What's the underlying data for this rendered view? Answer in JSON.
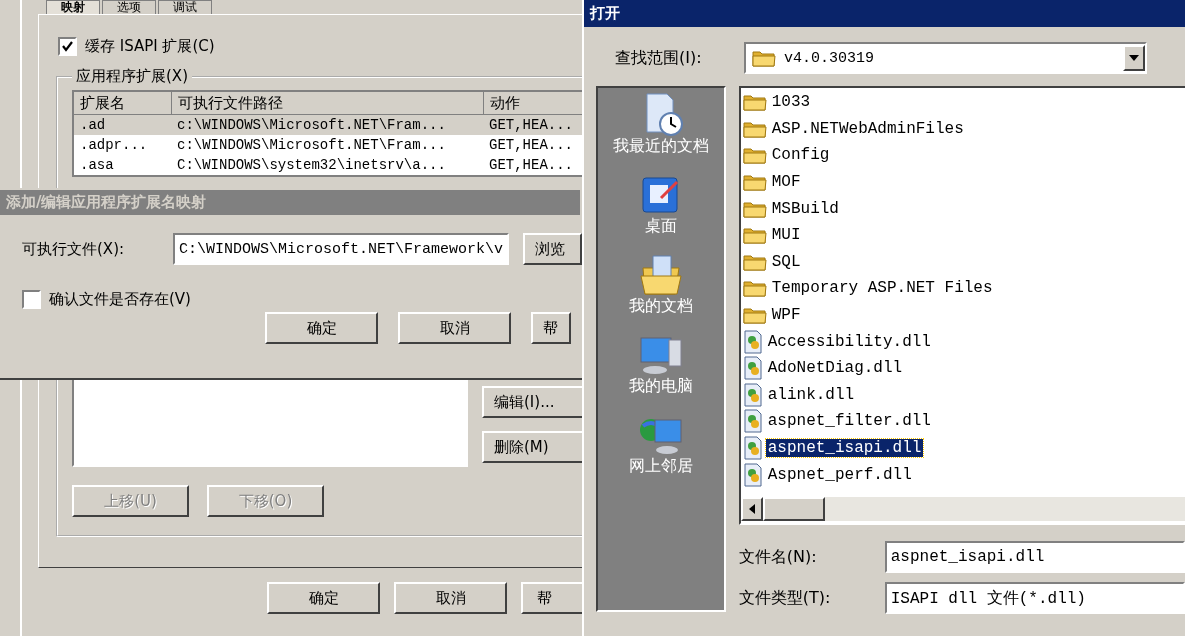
{
  "background_window": {
    "tabs": [
      {
        "label": "映射",
        "selected": true
      },
      {
        "label": "选项",
        "selected": false
      },
      {
        "label": "调试",
        "selected": false
      }
    ],
    "cache_checkbox": {
      "label": "缓存 ISAPI 扩展(C)",
      "checked": true
    },
    "group_label": "应用程序扩展(X)",
    "extensions_table": {
      "columns": [
        "扩展名",
        "可执行文件路径",
        "动作"
      ],
      "rows": [
        {
          "cells": [
            ".ad",
            "c:\\WINDOWS\\Microsoft.NET\\Fram...",
            "GET,HEA..."
          ],
          "selected": true
        },
        {
          "cells": [
            ".adpr...",
            "c:\\WINDOWS\\Microsoft.NET\\Fram...",
            "GET,HEA..."
          ],
          "selected": false
        },
        {
          "cells": [
            ".asa",
            "C:\\WINDOWS\\system32\\inetsrv\\a...",
            "GET,HEA..."
          ],
          "selected": false
        }
      ]
    },
    "wildcard_buttons": [
      {
        "label": "编辑(I)...",
        "disabled": false
      },
      {
        "label": "删除(M)",
        "disabled": false
      }
    ],
    "move_buttons": [
      {
        "label": "上移(U)",
        "disabled": true
      },
      {
        "label": "下移(O)",
        "disabled": true
      }
    ],
    "buttons": [
      "确定",
      "取消",
      "帮"
    ]
  },
  "edit_dialog": {
    "title": "添加/编辑应用程序扩展名映射",
    "active": false,
    "executable_label": "可执行文件(X):",
    "executable_value": "C:\\WINDOWS\\Microsoft.NET\\Framework\\v",
    "browse_button": "浏览",
    "verify_checkbox": {
      "label": "确认文件是否存在(V)",
      "checked": false
    },
    "buttons": [
      "确定",
      "取消",
      "帮"
    ]
  },
  "open_dialog": {
    "title": "打开",
    "active": true,
    "look_in_label": "查找范围(I):",
    "look_in_value": "v4.0.30319",
    "places": [
      {
        "label": "我最近的文档",
        "kind": "recent"
      },
      {
        "label": "桌面",
        "kind": "desktop"
      },
      {
        "label": "我的文档",
        "kind": "documents"
      },
      {
        "label": "我的电脑",
        "kind": "computer"
      },
      {
        "label": "网上邻居",
        "kind": "network"
      }
    ],
    "files": [
      {
        "name": "1033",
        "kind": "folder",
        "selected": false
      },
      {
        "name": "ASP.NETWebAdminFiles",
        "kind": "folder",
        "selected": false
      },
      {
        "name": "Config",
        "kind": "folder",
        "selected": false
      },
      {
        "name": "MOF",
        "kind": "folder",
        "selected": false
      },
      {
        "name": "MSBuild",
        "kind": "folder",
        "selected": false
      },
      {
        "name": "MUI",
        "kind": "folder",
        "selected": false
      },
      {
        "name": "SQL",
        "kind": "folder",
        "selected": false
      },
      {
        "name": "Temporary ASP.NET Files",
        "kind": "folder",
        "selected": false
      },
      {
        "name": "WPF",
        "kind": "folder",
        "selected": false
      },
      {
        "name": "Accessibility.dll",
        "kind": "dll",
        "selected": false
      },
      {
        "name": "AdoNetDiag.dll",
        "kind": "dll",
        "selected": false
      },
      {
        "name": "alink.dll",
        "kind": "dll",
        "selected": false
      },
      {
        "name": "aspnet_filter.dll",
        "kind": "dll",
        "selected": false
      },
      {
        "name": "aspnet_isapi.dll",
        "kind": "dll",
        "selected": true
      },
      {
        "name": "Aspnet_perf.dll",
        "kind": "dll",
        "selected": false
      }
    ],
    "file_name_label": "文件名(N):",
    "file_name_value": "aspnet_isapi.dll",
    "file_type_label": "文件类型(T):",
    "file_type_value": "ISAPI dll 文件(*.dll)"
  }
}
